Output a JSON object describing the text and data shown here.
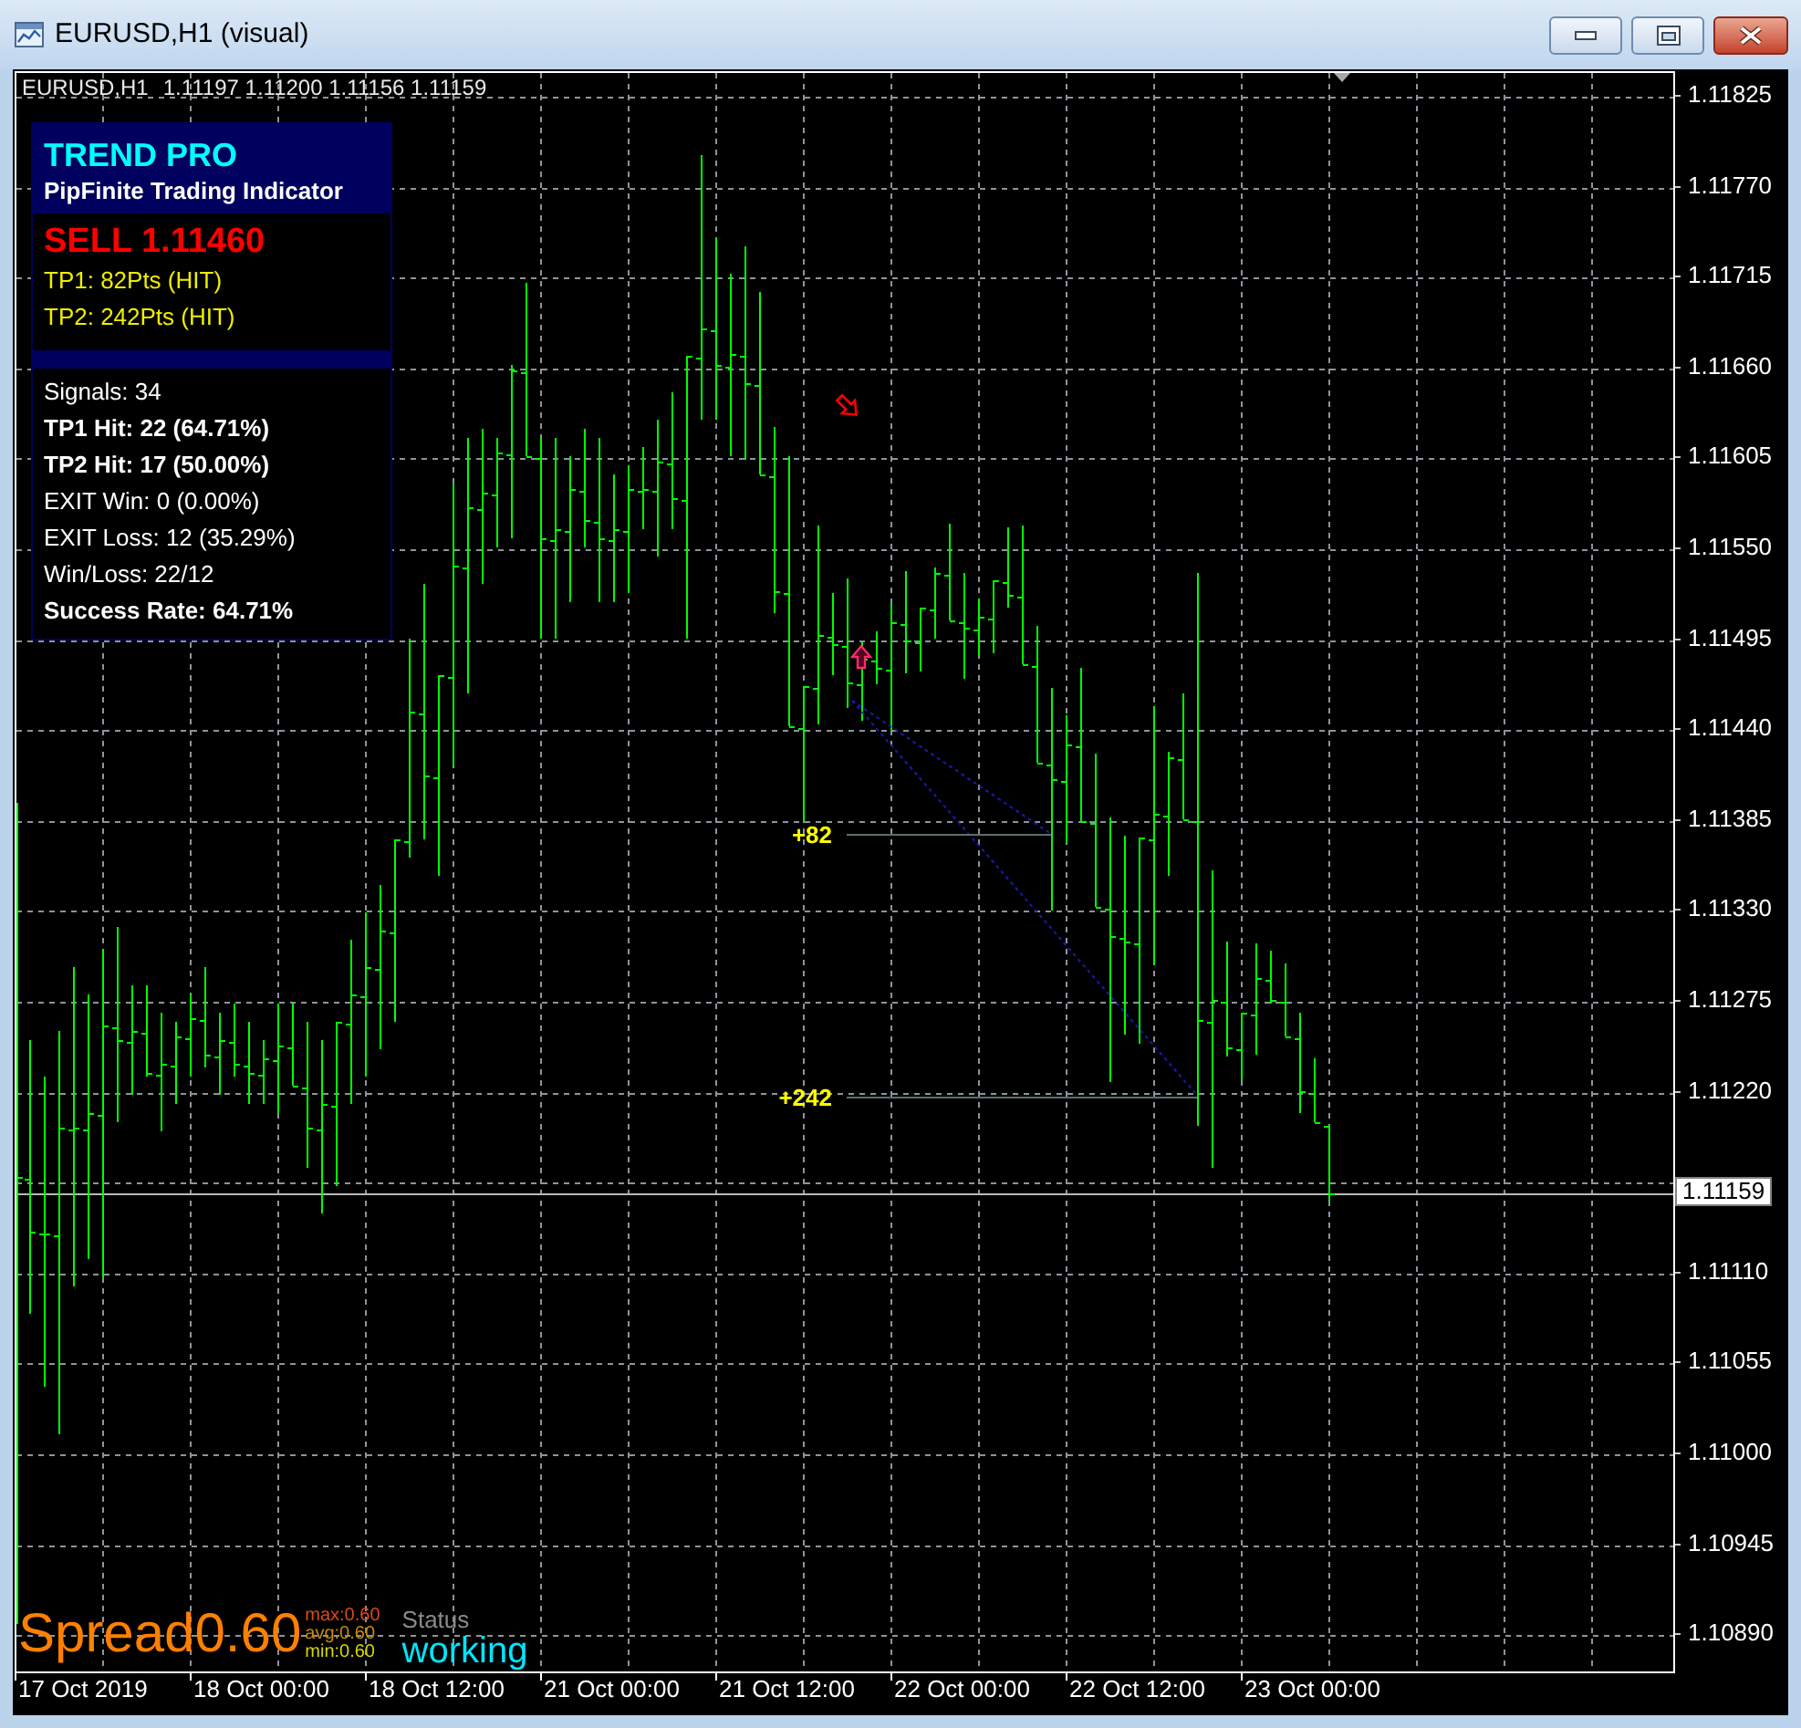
{
  "window": {
    "title": "EURUSD,H1 (visual)"
  },
  "chart": {
    "symbol": "EURUSD,H1",
    "quote": "1.11197 1.11200 1.11156 1.11159"
  },
  "signal_panel": {
    "title": "TREND PRO",
    "subtitle": "PipFinite Trading Indicator",
    "signal": "SELL 1.11460",
    "targets": [
      "TP1: 82Pts (HIT)",
      "TP2: 242Pts (HIT)"
    ],
    "stats": [
      {
        "text": "Signals: 34",
        "bold": false
      },
      {
        "text": "TP1 Hit: 22 (64.71%)",
        "bold": true
      },
      {
        "text": "TP2 Hit: 17 (50.00%)",
        "bold": true
      },
      {
        "text": "EXIT Win: 0 (0.00%)",
        "bold": false
      },
      {
        "text": "EXIT Loss: 12 (35.29%)",
        "bold": false
      },
      {
        "text": "Win/Loss: 22/12",
        "bold": false
      },
      {
        "text": "Success Rate: 64.71%",
        "bold": true
      }
    ]
  },
  "target_labels": [
    "+82",
    "+242"
  ],
  "spread": {
    "label": "Spread",
    "value": "0.60",
    "stats": [
      {
        "text": "max:0.60",
        "color": "#e0481a"
      },
      {
        "text": "avg:0.60",
        "color": "#c88a00"
      },
      {
        "text": "min:0.60",
        "color": "#d6d600"
      }
    ]
  },
  "status": {
    "label": "Status",
    "value": "working"
  },
  "price_axis": {
    "labels": [
      "1.11825",
      "1.11770",
      "1.11715",
      "1.11660",
      "1.11605",
      "1.11550",
      "1.11495",
      "1.11440",
      "1.11385",
      "1.11330",
      "1.11275",
      "1.11220",
      "1.11110",
      "1.11055",
      "1.11000",
      "1.10945",
      "1.10890"
    ],
    "current_price": "1.11159"
  },
  "time_axis": {
    "labels": [
      "17 Oct 2019",
      "18 Oct 00:00",
      "18 Oct 12:00",
      "21 Oct 00:00",
      "21 Oct 12:00",
      "22 Oct 00:00",
      "22 Oct 12:00",
      "23 Oct 00:00"
    ]
  }
}
